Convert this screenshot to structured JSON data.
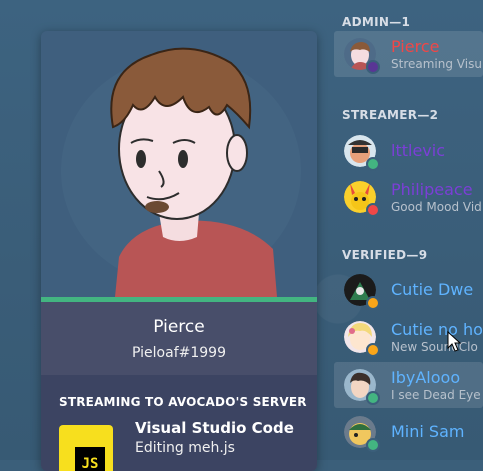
{
  "profile": {
    "name": "Pierce",
    "tag": "Pieloaf#1999",
    "activity_header": "STREAMING TO AVOCADO'S SERVER",
    "activity_icon": "js-icon",
    "activity_icon_text": "JS",
    "activity_name": "Visual Studio Code",
    "activity_details": "Editing meh.js",
    "accent_color": "#43b581"
  },
  "members": {
    "sections": [
      {
        "label": "ADMIN—1"
      },
      {
        "label": "STREAMER—2"
      },
      {
        "label": "VERIFIED—9"
      }
    ],
    "items": [
      {
        "name": "Pierce",
        "sub": "Streaming Visu",
        "color": "#f04747",
        "status": "streaming"
      },
      {
        "name": "lttlevic",
        "sub": "",
        "color": "#7b3fd6",
        "status": "online"
      },
      {
        "name": "Philipeace",
        "sub": "Good Mood Vid",
        "color": "#7b3fd6",
        "status": "dnd"
      },
      {
        "name": "Cutie Dwe",
        "sub": "",
        "color": "#5fb3ff",
        "status": "idle"
      },
      {
        "name": "Cutie no ho",
        "sub": "New SoundClo",
        "color": "#5fb3ff",
        "status": "idle"
      },
      {
        "name": "IbyAlooo",
        "sub": "I see Dead Eye",
        "color": "#5fb3ff",
        "status": "online"
      },
      {
        "name": "Mini Sam",
        "sub": "",
        "color": "#5fb3ff",
        "status": "online"
      }
    ]
  }
}
